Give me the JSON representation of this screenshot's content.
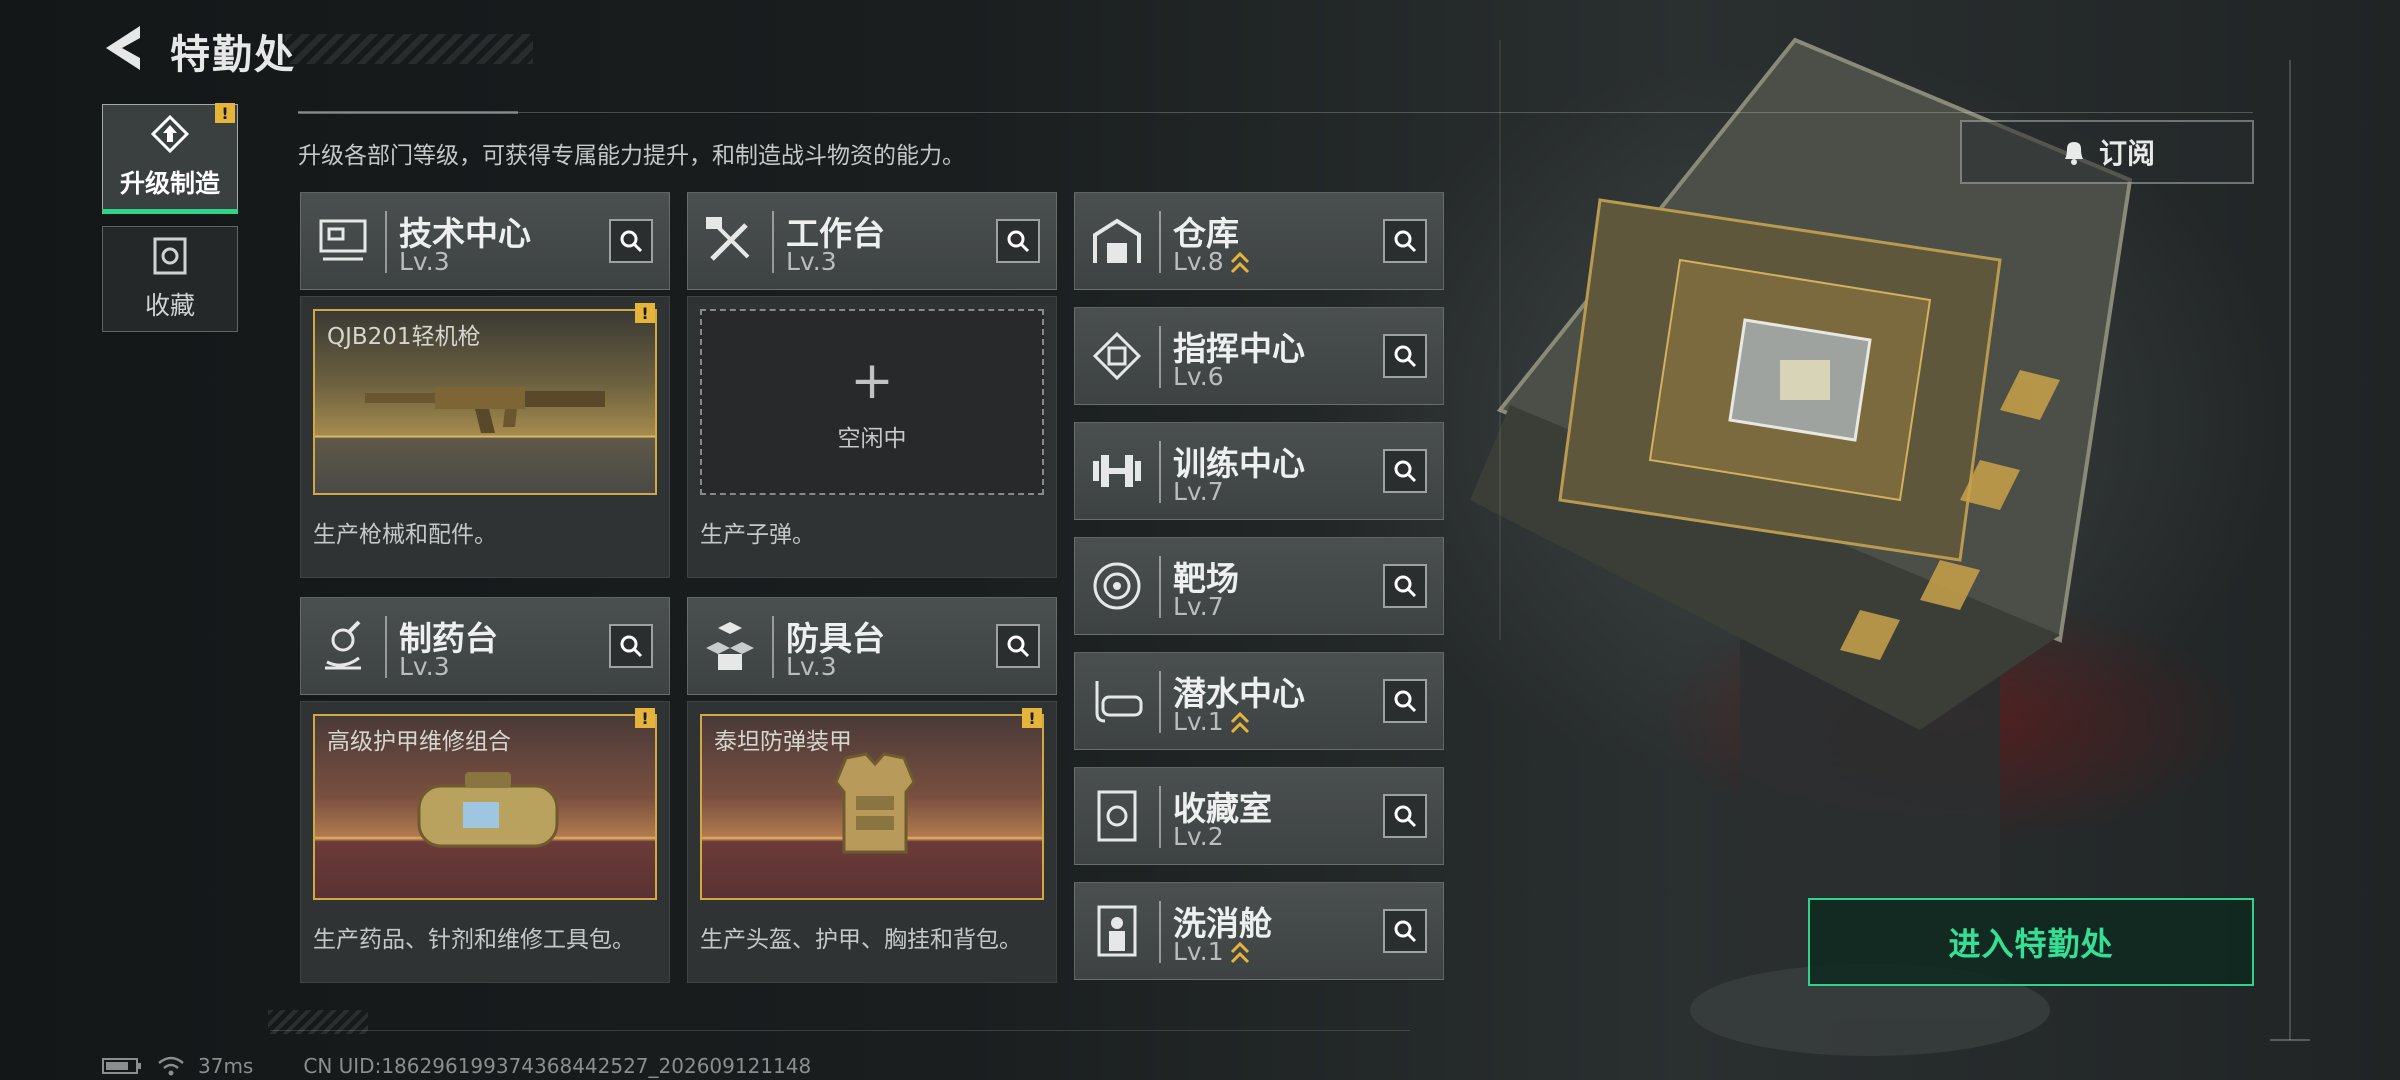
{
  "header": {
    "title": "特勤处"
  },
  "tabs": [
    {
      "label": "升级制造",
      "active": true,
      "alert": "!"
    },
    {
      "label": "收藏",
      "active": false
    }
  ],
  "description": "升级各部门等级，可获得专属能力提升，和制造战斗物资的能力。",
  "production_stations": [
    {
      "name": "技术中心",
      "level": "Lv.3",
      "icon": "monitor-icon",
      "slot_item": "QJB201轻机枪",
      "slot_alert": "!",
      "desc": "生产枪械和配件。"
    },
    {
      "name": "工作台",
      "level": "Lv.3",
      "icon": "tools-icon",
      "slot_idle_text": "空闲中",
      "desc": "生产子弹。"
    },
    {
      "name": "制药台",
      "level": "Lv.3",
      "icon": "microscope-icon",
      "slot_item": "高级护甲维修组合",
      "slot_alert": "!",
      "desc": "生产药品、针剂和维修工具包。"
    },
    {
      "name": "防具台",
      "level": "Lv.3",
      "icon": "armor-blocks-icon",
      "slot_item": "泰坦防弹装甲",
      "slot_alert": "!",
      "desc": "生产头盔、护甲、胸挂和背包。"
    }
  ],
  "facilities": [
    {
      "name": "仓库",
      "level": "Lv.8",
      "upgradable": true,
      "icon": "warehouse-icon"
    },
    {
      "name": "指挥中心",
      "level": "Lv.6",
      "upgradable": false,
      "icon": "chip-icon"
    },
    {
      "name": "训练中心",
      "level": "Lv.7",
      "upgradable": false,
      "icon": "dumbbell-icon"
    },
    {
      "name": "靶场",
      "level": "Lv.7",
      "upgradable": false,
      "icon": "target-icon"
    },
    {
      "name": "潜水中心",
      "level": "Lv.1",
      "upgradable": true,
      "icon": "diving-mask-icon"
    },
    {
      "name": "收藏室",
      "level": "Lv.2",
      "upgradable": false,
      "icon": "collection-icon"
    },
    {
      "name": "洗消舱",
      "level": "Lv.1",
      "upgradable": true,
      "icon": "decon-icon"
    }
  ],
  "subscribe_label": "订阅",
  "enter_label": "进入特勤处",
  "status": {
    "ping": "37ms",
    "uid": "CN UID:1862961993743684425​27_202609121148"
  },
  "colors": {
    "accent_green": "#2fd38a",
    "alert_gold": "#e5b43a",
    "slot_border": "#d2a845"
  }
}
